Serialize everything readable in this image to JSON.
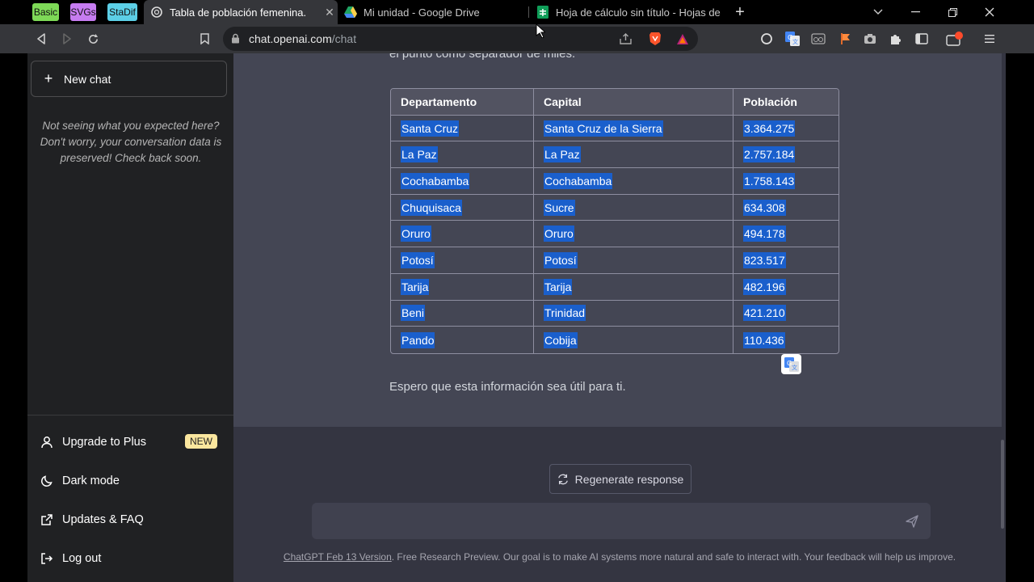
{
  "browser": {
    "pinned_tabs": [
      {
        "label": "Basic",
        "color": "#7ed957"
      },
      {
        "label": "SVGs",
        "color": "#c67cf0"
      },
      {
        "label": "StaDif",
        "color": "#5ccfe6"
      }
    ],
    "tabs": [
      {
        "title": "Tabla de población femenina.",
        "active": true,
        "icon": "openai-icon"
      },
      {
        "title": "Mi unidad - Google Drive",
        "active": false,
        "icon": "google-drive-icon"
      },
      {
        "title": "Hoja de cálculo sin título - Hojas de cálculo",
        "active": false,
        "icon": "google-sheets-icon"
      }
    ],
    "new_tab_symbol": "+",
    "url_domain": "chat.openai.com",
    "url_path": "/chat"
  },
  "sidebar": {
    "new_chat_label": "New chat",
    "notice": "Not seeing what you expected here? Don't worry, your conversation data is preserved! Check back soon.",
    "items": [
      {
        "label": "Upgrade to Plus",
        "icon": "user-icon",
        "badge": "NEW"
      },
      {
        "label": "Dark mode",
        "icon": "moon-icon"
      },
      {
        "label": "Updates & FAQ",
        "icon": "external-link-icon"
      },
      {
        "label": "Log out",
        "icon": "logout-icon"
      }
    ]
  },
  "conversation": {
    "previous_text": "el punto como separador de miles.",
    "table": {
      "headers": [
        "Departamento",
        "Capital",
        "Población"
      ],
      "rows": [
        [
          "Santa Cruz",
          "Santa Cruz de la Sierra",
          "3.364.275"
        ],
        [
          "La Paz",
          "La Paz",
          "2.757.184"
        ],
        [
          "Cochabamba",
          "Cochabamba",
          "1.758.143"
        ],
        [
          "Chuquisaca",
          "Sucre",
          "634.308"
        ],
        [
          "Oruro",
          "Oruro",
          "494.178"
        ],
        [
          "Potosí",
          "Potosí",
          "823.517"
        ],
        [
          "Tarija",
          "Tarija",
          "482.196"
        ],
        [
          "Beni",
          "Trinidad",
          "421.210"
        ],
        [
          "Pando",
          "Cobija",
          "110.436"
        ]
      ]
    },
    "closing_text": "Espero que esta información sea útil para ti."
  },
  "composer": {
    "regenerate_label": "Regenerate response",
    "placeholder": ""
  },
  "footer": {
    "version_link": "ChatGPT Feb 13 Version",
    "text": ". Free Research Preview. Our goal is to make AI systems more natural and safe to interact with. Your feedback will help us improve."
  },
  "colors": {
    "selection": "#1a5fcc",
    "sidebar_bg": "#202123",
    "message_bg": "#444654",
    "main_bg": "#343541"
  }
}
